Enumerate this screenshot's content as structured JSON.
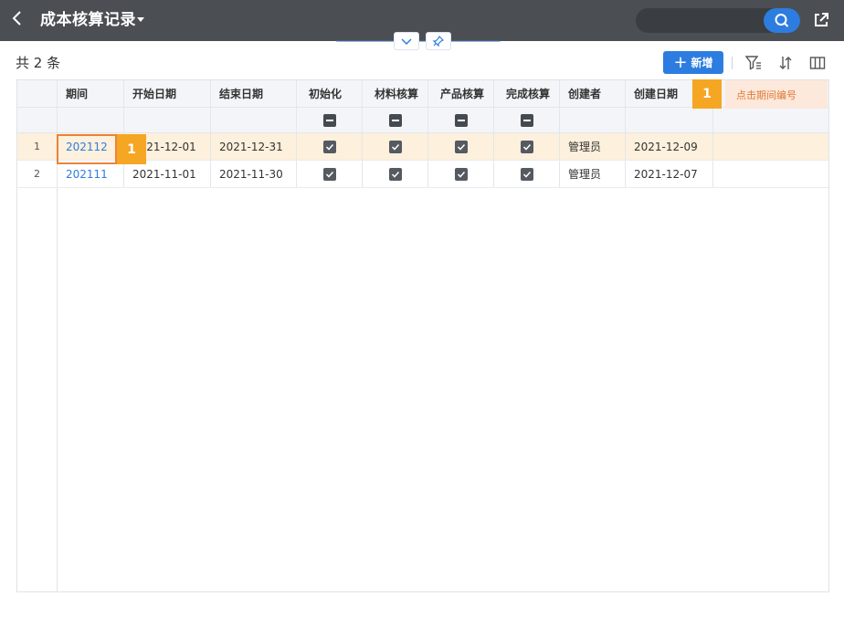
{
  "header": {
    "title": "成本核算记录"
  },
  "toolbar": {
    "count_label": "共 2 条",
    "add_label": "新增"
  },
  "table": {
    "columns": [
      "期间",
      "开始日期",
      "结束日期",
      "初始化",
      "材料核算",
      "产品核算",
      "完成核算",
      "创建者",
      "创建日期"
    ],
    "rows": [
      {
        "num": "1",
        "period": "202112",
        "start": "2021-12-01",
        "end": "2021-12-31",
        "init": true,
        "material": true,
        "product": true,
        "complete": true,
        "creator": "管理员",
        "created": "2021-12-09"
      },
      {
        "num": "2",
        "period": "202111",
        "start": "2021-11-01",
        "end": "2021-11-30",
        "init": true,
        "material": true,
        "product": true,
        "complete": true,
        "creator": "管理员",
        "created": "2021-12-07"
      }
    ]
  },
  "tutorial": {
    "step": "1",
    "hint": "点击期间编号",
    "row_step": "1"
  },
  "colors": {
    "header_bg": "#4b4f54",
    "accent": "#2d7de0",
    "highlight_row": "#fdf0dc",
    "badge": "#f5a623"
  }
}
